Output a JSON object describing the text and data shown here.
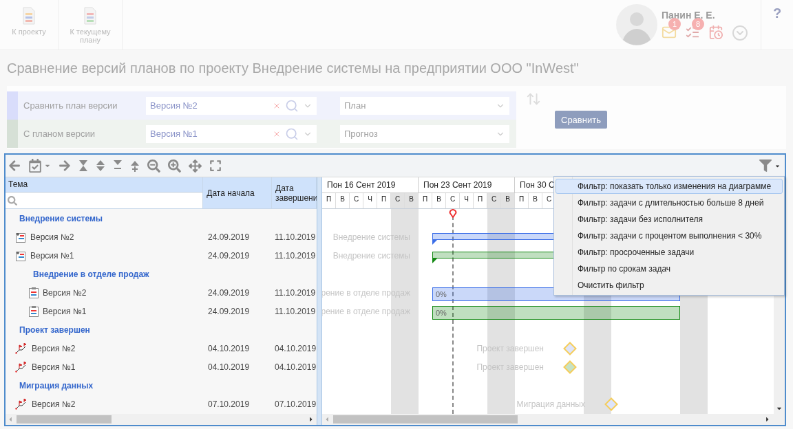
{
  "header": {
    "nav": [
      {
        "kind": "project",
        "label": "К проекту"
      },
      {
        "kind": "plan",
        "label": "К текущему плану"
      }
    ],
    "user": {
      "name": "Панин Е. Е.",
      "notifications": [
        {
          "kind": "mail",
          "count": "1"
        },
        {
          "kind": "tasks",
          "count": "8"
        },
        {
          "kind": "calendar"
        }
      ]
    },
    "help": "?"
  },
  "title": "Сравнение версий планов по проекту Внедрение системы на предприятии ООО \"InWest\"",
  "compare": {
    "rows": [
      {
        "label": "Сравнить план версии",
        "version": "Версия №2",
        "plan_type": "План",
        "color": "#d9ddfb"
      },
      {
        "label": "С планом версии",
        "version": "Версия №1",
        "plan_type": "Прогноз",
        "color": "#d6e0d6"
      }
    ],
    "button": "Сравнить"
  },
  "gantt": {
    "columns": [
      "Тема",
      "Дата начала",
      "Дата завершени"
    ],
    "weeks": [
      {
        "label": "Пон 16 Сент 2019",
        "days": [
          "П",
          "В",
          "С",
          "Ч",
          "П",
          "С",
          "В"
        ]
      },
      {
        "label": "Пон 23 Сент 2019",
        "days": [
          "П",
          "В",
          "С",
          "Ч",
          "П",
          "С",
          "В"
        ]
      },
      {
        "label": "Пон 30 С",
        "days": [
          "П",
          "В",
          "С"
        ]
      }
    ],
    "rows": [
      {
        "kind": "group",
        "title": "Внедрение системы",
        "children": [
          {
            "kind": "summary",
            "title": "Версия №2",
            "start": "24.09.2019",
            "end": "11.10.2019",
            "chart_label": "Внедрение системы",
            "color": "#3a6ee8"
          },
          {
            "kind": "summary",
            "title": "Версия №1",
            "start": "24.09.2019",
            "end": "11.10.2019",
            "chart_label": "Внедрение системы",
            "color": "#118811"
          },
          {
            "kind": "group",
            "title": "Внедрение в отделе продаж",
            "children": [
              {
                "kind": "task",
                "title": "Версия №2",
                "start": "24.09.2019",
                "end": "11.10.2019",
                "chart_label": "рение в отделе продаж",
                "progress": "0%",
                "color": "#3a6ee8"
              },
              {
                "kind": "task",
                "title": "Версия №1",
                "start": "24.09.2019",
                "end": "11.10.2019",
                "chart_label": "рение в отделе продаж",
                "progress": "0%",
                "color": "#118811"
              }
            ]
          }
        ]
      },
      {
        "kind": "group",
        "title": "Проект завершен",
        "children": [
          {
            "kind": "milestone",
            "title": "Версия №2",
            "start": "04.10.2019",
            "end": "04.10.2019",
            "chart_label": "Проект завершен",
            "color": "#dde4fb"
          },
          {
            "kind": "milestone",
            "title": "Версия №1",
            "start": "04.10.2019",
            "end": "04.10.2019",
            "chart_label": "Проект завершен",
            "color": "#c6e2c6"
          }
        ]
      },
      {
        "kind": "group",
        "title": "Миграция данных",
        "children": [
          {
            "kind": "milestone",
            "title": "Версия №2",
            "start": "07.10.2019",
            "end": "07.10.2019",
            "chart_label": "Миграция данных",
            "color": "#dde4fb"
          }
        ]
      }
    ],
    "filter_menu": [
      {
        "label": "Фильтр: показать только изменения на диаграмме",
        "selected": true
      },
      {
        "label": "Фильтр: задачи с длительностью больше 8 дней",
        "selected": false
      },
      {
        "label": "Фильтр: задачи без исполнителя",
        "selected": false
      },
      {
        "label": "Фильтр: задачи с процентом выполнения < 30%",
        "selected": false
      },
      {
        "label": "Фильтр: просроченные задачи",
        "selected": false
      },
      {
        "label": "Фильтр по срокам задач",
        "selected": false
      },
      {
        "label": "Очистить фильтр",
        "selected": false
      }
    ]
  }
}
